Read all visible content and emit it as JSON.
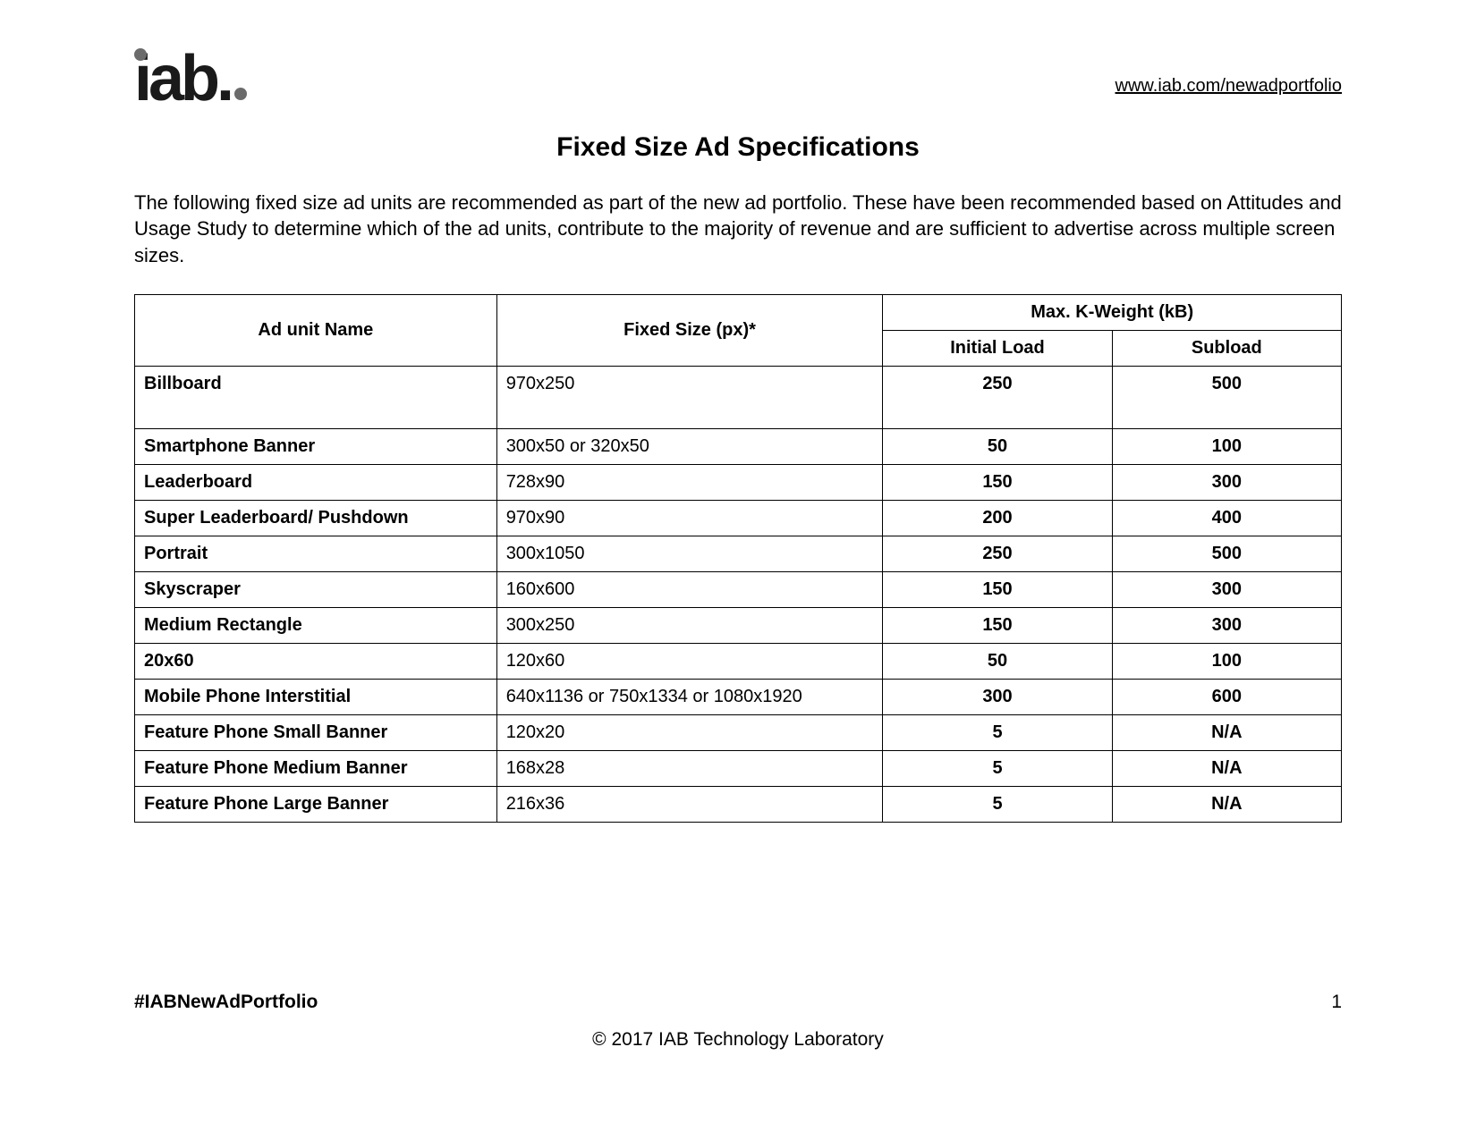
{
  "header": {
    "logo_text": "iab.",
    "link_text": "www.iab.com/newadportfolio"
  },
  "title": "Fixed Size Ad Specifications",
  "intro": "The following fixed size ad units are recommended as part of the new ad portfolio. These have been recommended based on Attitudes and Usage Study to determine which of the ad units, contribute to the majority of revenue and are sufficient to advertise across multiple screen sizes.",
  "table": {
    "col_name": "Ad unit Name",
    "col_size": "Fixed Size (px)*",
    "col_weight_group": "Max. K-Weight (kB)",
    "col_initial": "Initial Load",
    "col_subload": "Subload",
    "rows": [
      {
        "name": "Billboard",
        "size": "970x250",
        "initial": "250",
        "subload": "500",
        "tall": true
      },
      {
        "name": "Smartphone Banner",
        "size": "300x50 or 320x50",
        "initial": "50",
        "subload": "100"
      },
      {
        "name": "Leaderboard",
        "size": "728x90",
        "initial": "150",
        "subload": "300"
      },
      {
        "name": "Super Leaderboard/ Pushdown",
        "size": "970x90",
        "initial": "200",
        "subload": "400"
      },
      {
        "name": "Portrait",
        "size": "300x1050",
        "initial": "250",
        "subload": "500"
      },
      {
        "name": "Skyscraper",
        "size": "160x600",
        "initial": "150",
        "subload": "300"
      },
      {
        "name": "Medium Rectangle",
        "size": "300x250",
        "initial": "150",
        "subload": "300"
      },
      {
        "name": "20x60",
        "size": "120x60",
        "initial": "50",
        "subload": "100"
      },
      {
        "name": "Mobile Phone Interstitial",
        "size": "640x1136 or 750x1334 or 1080x1920",
        "initial": "300",
        "subload": "600"
      },
      {
        "name": "Feature Phone Small Banner",
        "size": "120x20",
        "initial": "5",
        "subload": "N/A"
      },
      {
        "name": "Feature Phone Medium Banner",
        "size": "168x28",
        "initial": "5",
        "subload": "N/A"
      },
      {
        "name": "Feature Phone Large Banner",
        "size": "216x36",
        "initial": "5",
        "subload": "N/A"
      }
    ]
  },
  "footer": {
    "hashtag": "#IABNewAdPortfolio",
    "page_number": "1",
    "copyright": "© 2017 IAB Technology Laboratory"
  },
  "chart_data": {
    "type": "table",
    "title": "Fixed Size Ad Specifications",
    "columns": [
      "Ad unit Name",
      "Fixed Size (px)*",
      "Initial Load (kB)",
      "Subload (kB)"
    ],
    "rows": [
      [
        "Billboard",
        "970x250",
        250,
        500
      ],
      [
        "Smartphone Banner",
        "300x50 or 320x50",
        50,
        100
      ],
      [
        "Leaderboard",
        "728x90",
        150,
        300
      ],
      [
        "Super Leaderboard/ Pushdown",
        "970x90",
        200,
        400
      ],
      [
        "Portrait",
        "300x1050",
        250,
        500
      ],
      [
        "Skyscraper",
        "160x600",
        150,
        300
      ],
      [
        "Medium Rectangle",
        "300x250",
        150,
        300
      ],
      [
        "20x60",
        "120x60",
        50,
        100
      ],
      [
        "Mobile Phone Interstitial",
        "640x1136 or 750x1334 or 1080x1920",
        300,
        600
      ],
      [
        "Feature Phone Small Banner",
        "120x20",
        5,
        null
      ],
      [
        "Feature Phone Medium Banner",
        "168x28",
        5,
        null
      ],
      [
        "Feature Phone Large Banner",
        "216x36",
        5,
        null
      ]
    ]
  }
}
